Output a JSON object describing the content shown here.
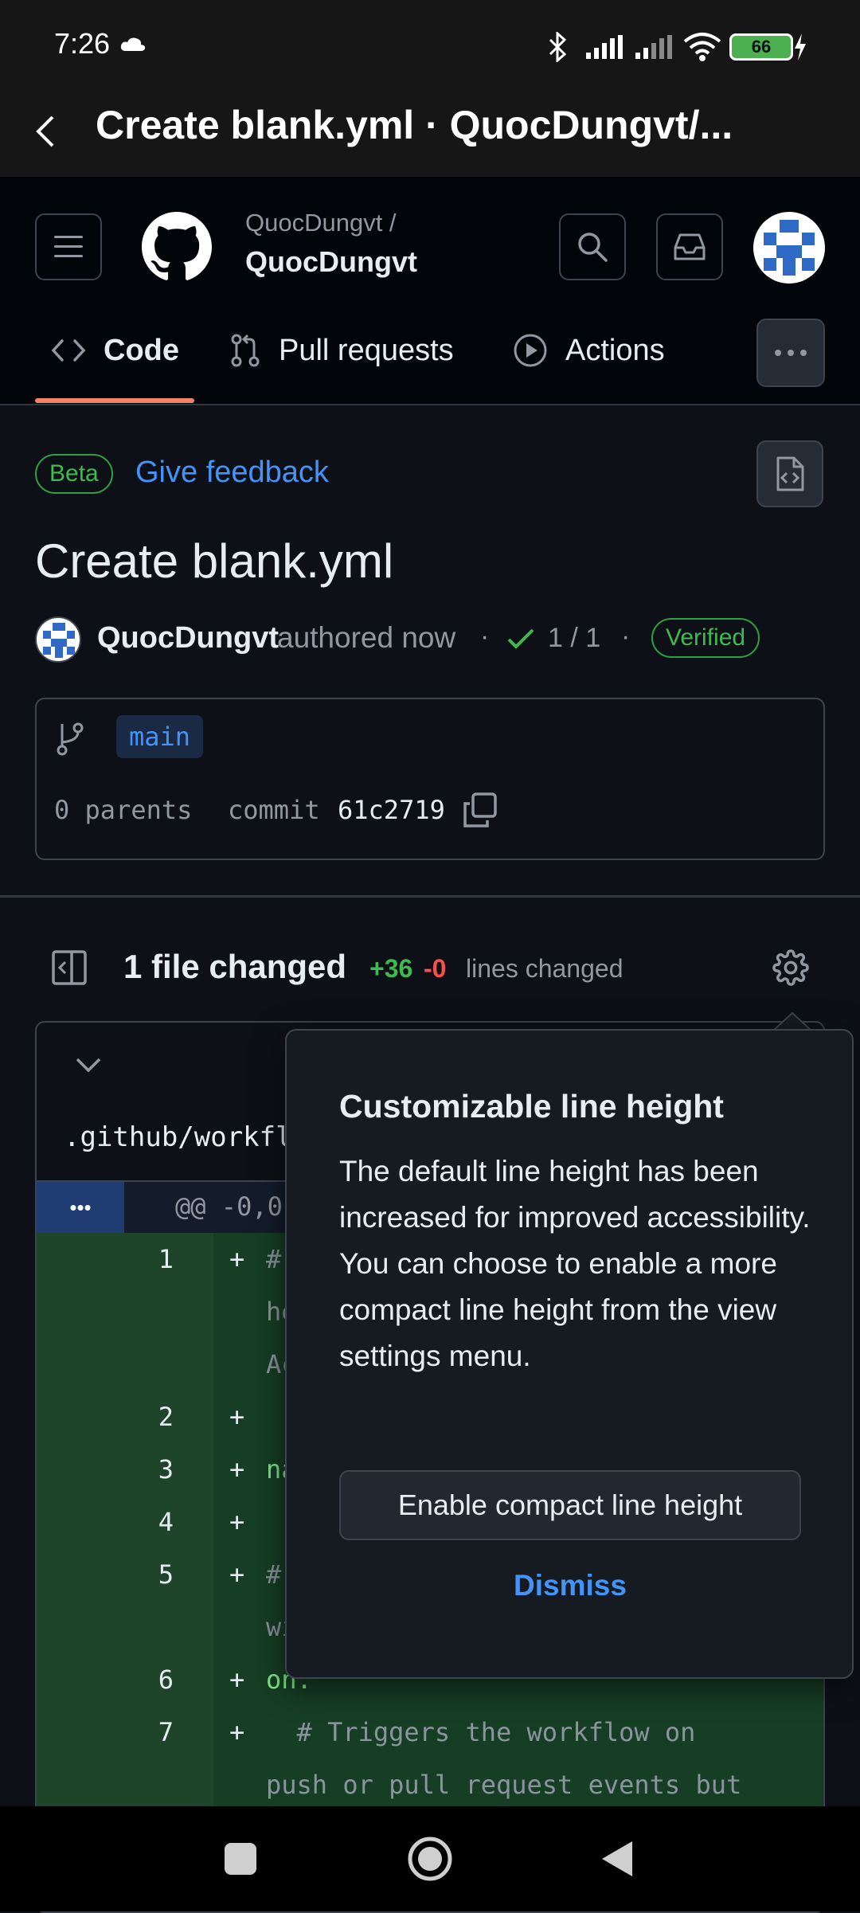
{
  "status_bar": {
    "time": "7:26",
    "battery": "66"
  },
  "app_bar": {
    "title": "Create blank.yml · QuocDungvt/..."
  },
  "repo": {
    "owner_label": "QuocDungvt /",
    "name": "QuocDungvt"
  },
  "tabs": [
    {
      "label": "Code"
    },
    {
      "label": "Pull requests"
    },
    {
      "label": "Actions"
    }
  ],
  "feedback": {
    "beta_label": "Beta",
    "give_feedback_label": "Give feedback"
  },
  "commit": {
    "title": "Create blank.yml",
    "author": "QuocDungvt",
    "authored": "authored now",
    "checks": "1 / 1",
    "verified_label": "Verified",
    "branch": "main",
    "parents": "0 parents",
    "commit_label": "commit",
    "sha": "61c2719"
  },
  "files": {
    "changed_label": "1 file changed",
    "additions": "+36",
    "deletions": "-0",
    "lines_changed_label": "lines changed",
    "file_path": ".github/workfl",
    "hunk_header": "@@ -0,0",
    "expand_label": "•••"
  },
  "diff_lines": [
    {
      "num": "1",
      "sign": "+",
      "code": "# "
    },
    {
      "num": "",
      "sign": "",
      "code": "he"
    },
    {
      "num": "",
      "sign": "",
      "code": "Ac"
    },
    {
      "num": "2",
      "sign": "+",
      "code": ""
    },
    {
      "num": "3",
      "sign": "+",
      "code": "na"
    },
    {
      "num": "4",
      "sign": "+",
      "code": ""
    },
    {
      "num": "5",
      "sign": "+",
      "code": "# "
    },
    {
      "num": "",
      "sign": "",
      "code": "wi"
    },
    {
      "num": "6",
      "sign": "+",
      "code": "on:"
    },
    {
      "num": "7",
      "sign": "+",
      "code": "  # Triggers the workflow on"
    },
    {
      "num": "",
      "sign": "",
      "code": "push or pull request events but"
    }
  ],
  "popover": {
    "title": "Customizable line height",
    "body": "The default line height has been increased for improved accessibility. You can choose to enable a more compact line height from the view settings menu.",
    "enable_button": "Enable compact line height",
    "dismiss_button": "Dismiss"
  },
  "colors": {
    "accent_link": "#4493f8",
    "green": "#3fb950",
    "red": "#f85149",
    "tab_underline": "#f78166",
    "diff_num_bg": "#1e4429",
    "diff_code_bg": "#163e24"
  }
}
